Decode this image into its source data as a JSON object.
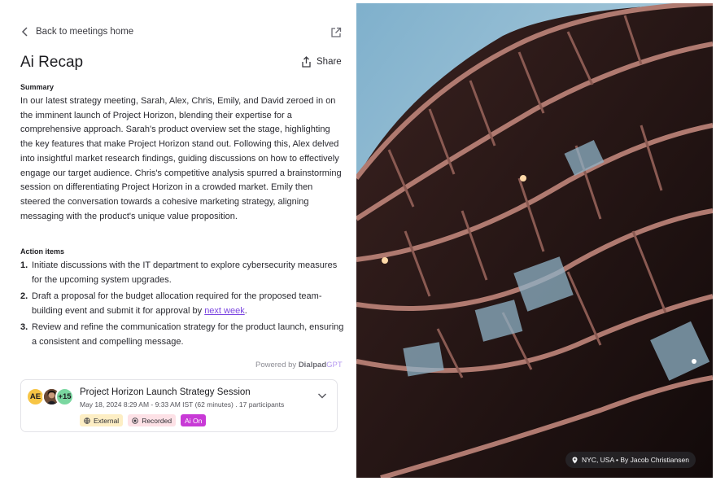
{
  "nav": {
    "back_label": "Back to meetings home",
    "external_icon": "external-link-icon"
  },
  "header": {
    "title": "Ai Recap",
    "share_label": "Share"
  },
  "summary": {
    "label": "Summary",
    "text": "In our latest strategy meeting, Sarah, Alex, Chris, Emily, and David zeroed in on the imminent launch of Project Horizon, blending their expertise for a comprehensive approach. Sarah's product overview set the stage, highlighting the key features that make Project Horizon stand out. Following this, Alex delved into insightful market research findings, guiding discussions on how to effectively engage our target audience. Chris's competitive analysis spurred a brainstorming session on differentiating Project Horizon in a crowded market. Emily then steered the conversation towards a cohesive marketing strategy, aligning messaging with the product's unique value proposition."
  },
  "action_items": {
    "label": "Action items",
    "items": [
      {
        "num": "1.",
        "text": "Initiate discussions with the IT department to explore cybersecurity measures for the upcoming system upgrades."
      },
      {
        "num": "2.",
        "text_before": "Draft a proposal for the budget allocation required for the proposed team-building event and submit it for approval by ",
        "link": "next week",
        "text_after": "."
      },
      {
        "num": "3.",
        "text": "Review and refine the communication strategy for the product launch, ensuring a consistent and compelling message."
      }
    ]
  },
  "powered": {
    "prefix": "Powered by ",
    "brand": "Dialpad",
    "suffix": "GPT"
  },
  "meeting_card": {
    "avatar_initials": "AE",
    "more_participants": "+15",
    "title": "Project Horizon Launch Strategy Session",
    "details": "May 18, 2024 8:29 AM - 9:33 AM IST (62 minutes) . 17 participants",
    "tags": {
      "external": "External",
      "recorded": "Recorded",
      "ai": "Ai On"
    }
  },
  "photo": {
    "caption": "NYC, USA • By Jacob Christiansen"
  },
  "colors": {
    "accent": "#7b45e0",
    "ai_tag": "#c83ad6",
    "avatar_ae": "#f7c545",
    "avatar_more": "#7ad7a0"
  }
}
